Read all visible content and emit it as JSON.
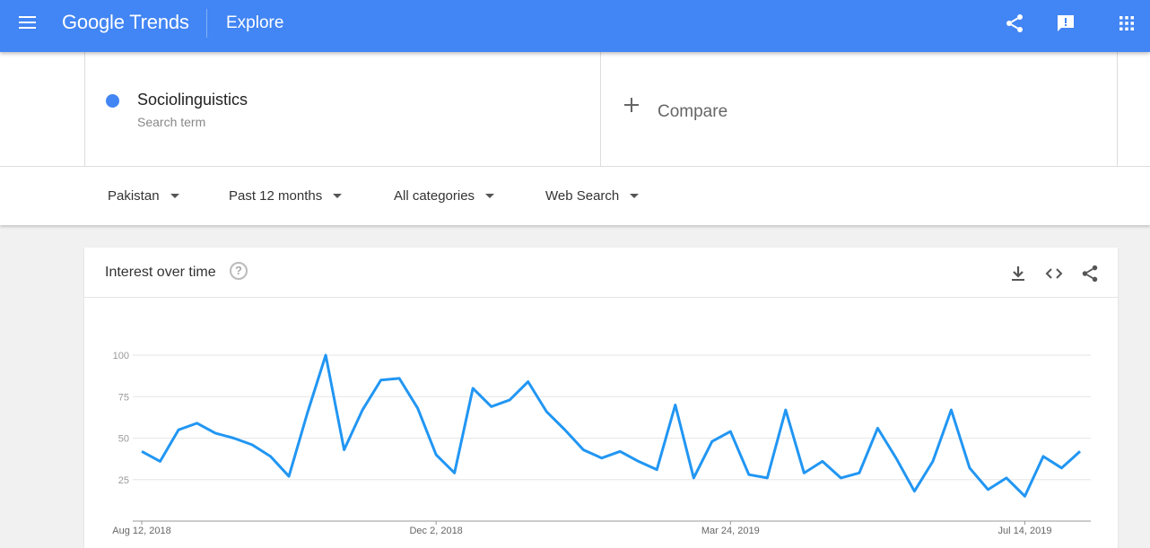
{
  "header": {
    "logo_text": "Google Trends",
    "section": "Explore",
    "icons": [
      "menu-icon",
      "share-icon",
      "feedback-icon",
      "apps-icon"
    ]
  },
  "search_term": {
    "name": "Sociolinguistics",
    "subtitle": "Search term",
    "color": "#4285f4"
  },
  "compare": {
    "label": "Compare"
  },
  "filters": [
    {
      "label": "Pakistan"
    },
    {
      "label": "Past 12 months"
    },
    {
      "label": "All categories"
    },
    {
      "label": "Web Search"
    }
  ],
  "card": {
    "title": "Interest over time",
    "help_symbol": "?",
    "icons": [
      "download-icon",
      "embed-icon",
      "share-icon"
    ]
  },
  "chart_data": {
    "type": "line",
    "title": "",
    "xlabel": "",
    "ylabel": "",
    "ylim": [
      0,
      100
    ],
    "y_ticks": [
      25,
      50,
      75,
      100
    ],
    "x_tick_labels": [
      {
        "label": "Aug 12, 2018",
        "index": 0
      },
      {
        "label": "Dec 2, 2018",
        "index": 16
      },
      {
        "label": "Mar 24, 2019",
        "index": 32
      },
      {
        "label": "Jul 14, 2019",
        "index": 48
      }
    ],
    "grid": true,
    "series": [
      {
        "color": "#2196f3",
        "values": [
          42,
          36,
          55,
          59,
          53,
          50,
          46,
          39,
          27,
          65,
          100,
          43,
          67,
          85,
          86,
          68,
          40,
          29,
          80,
          69,
          73,
          84,
          66,
          55,
          43,
          38,
          42,
          36,
          31,
          70,
          26,
          48,
          54,
          28,
          26,
          67,
          29,
          36,
          26,
          29,
          56,
          38,
          18,
          36,
          67,
          32,
          19,
          26,
          15,
          39,
          32,
          42
        ]
      }
    ]
  }
}
